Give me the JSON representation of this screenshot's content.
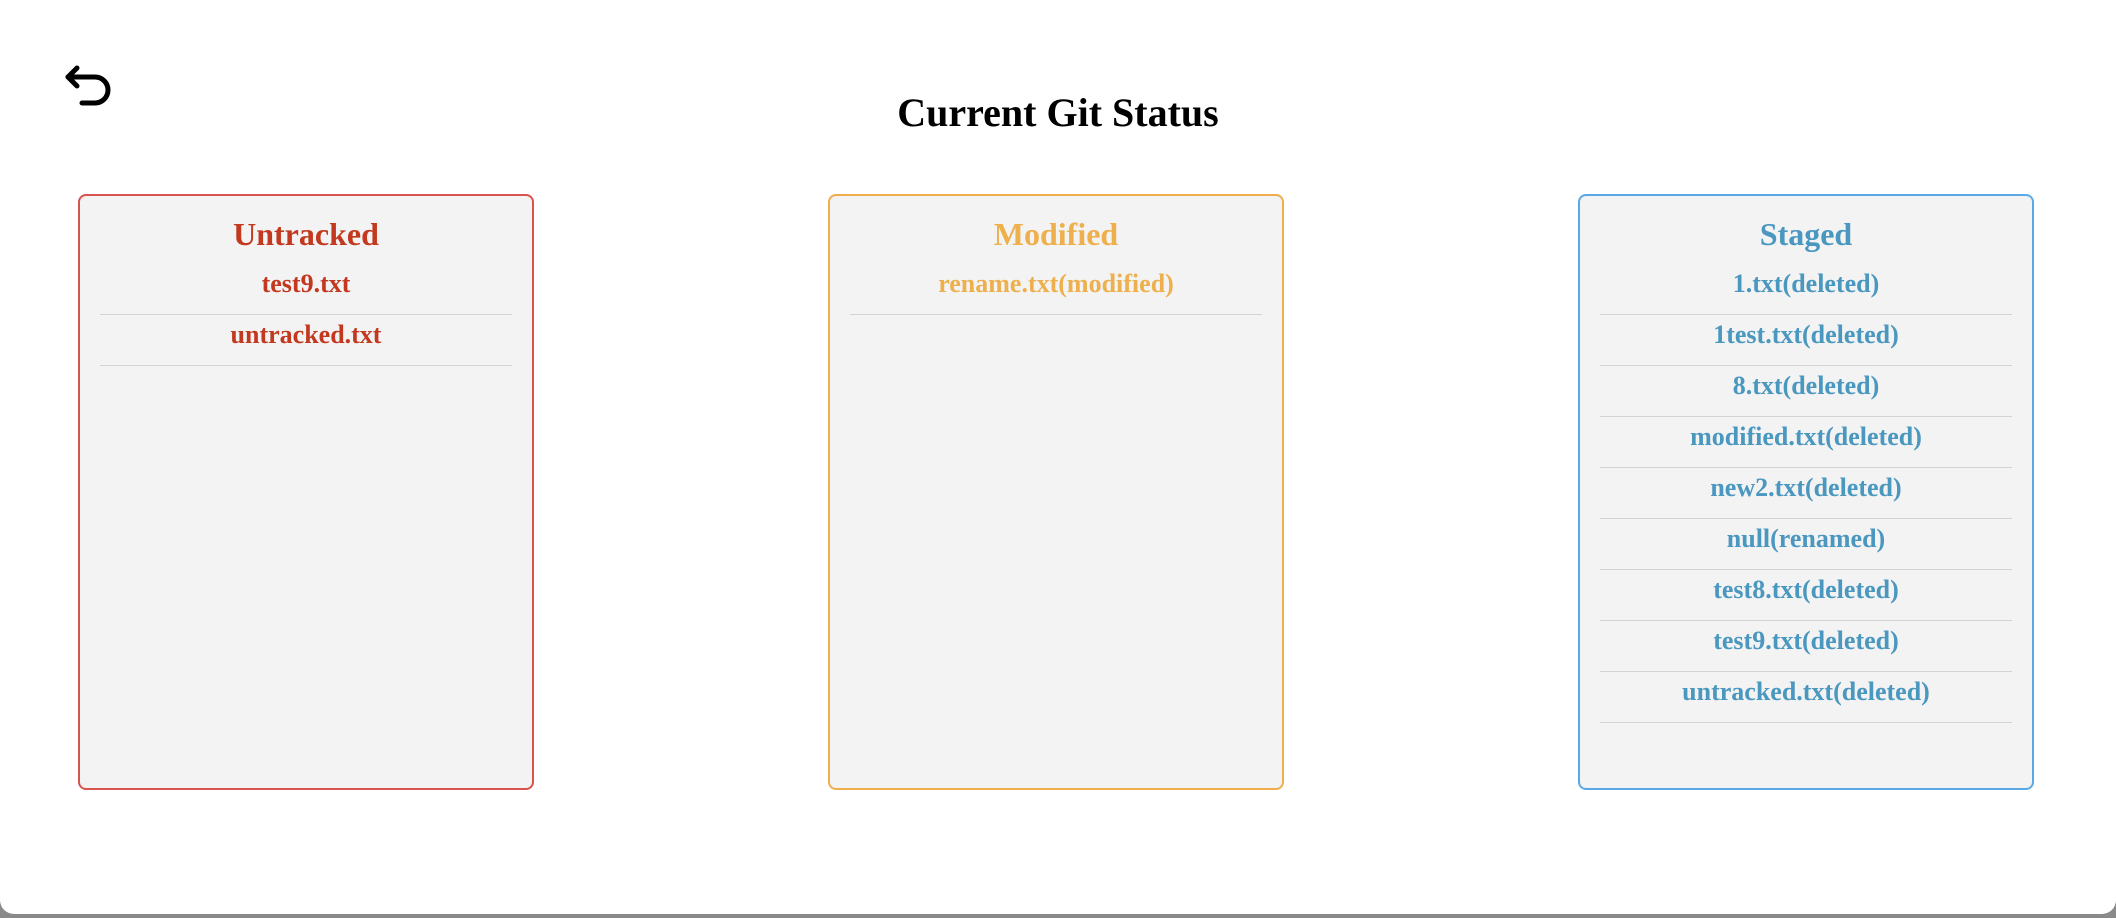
{
  "header": {
    "title": "Current Git Status",
    "back_icon": "undo-arrow-icon"
  },
  "colors": {
    "untracked": "#c2391f",
    "modified": "#eeb04c",
    "staged": "#4a97bf",
    "untracked_border": "#d9534f",
    "modified_border": "#f0ad4e",
    "staged_border": "#5aa9e6",
    "panel_background": "#f3f3f3"
  },
  "panels": {
    "untracked": {
      "title": "Untracked",
      "files": [
        "test9.txt",
        "untracked.txt"
      ]
    },
    "modified": {
      "title": "Modified",
      "files": [
        "rename.txt(modified)"
      ]
    },
    "staged": {
      "title": "Staged",
      "files": [
        "1.txt(deleted)",
        "1test.txt(deleted)",
        "8.txt(deleted)",
        "modified.txt(deleted)",
        "new2.txt(deleted)",
        "null(renamed)",
        "test8.txt(deleted)",
        "test9.txt(deleted)",
        "untracked.txt(deleted)"
      ]
    }
  }
}
